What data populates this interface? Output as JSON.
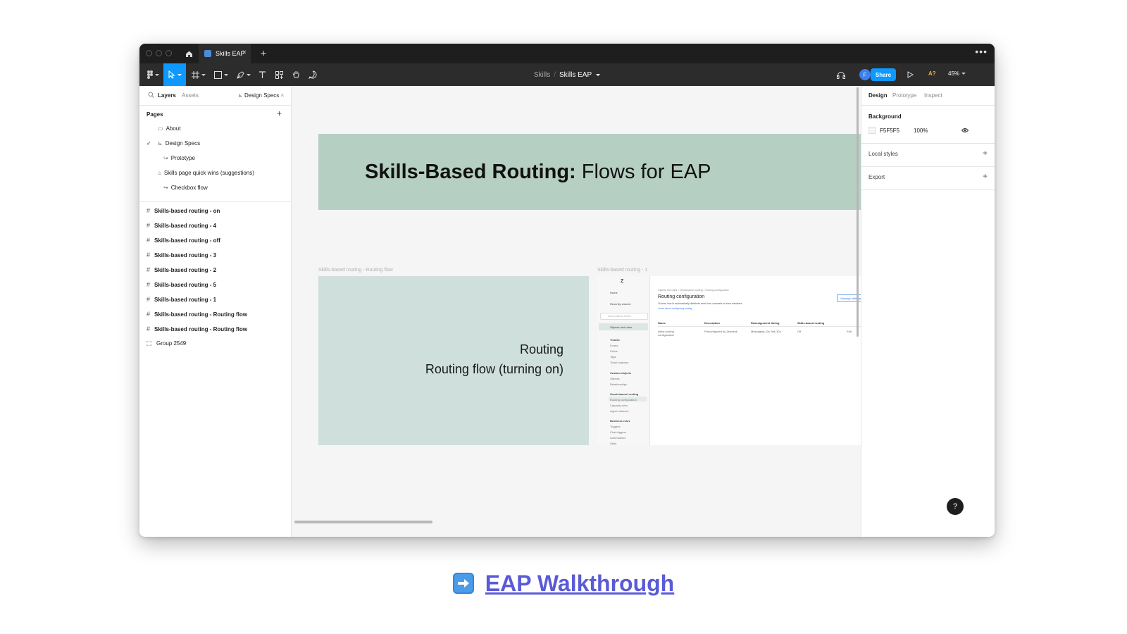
{
  "titlebar": {
    "tab_label": "Skills EAP",
    "tab_close": "×",
    "tab_add": "+",
    "more": "•••"
  },
  "toolbar": {
    "project": "Skills",
    "separator": "/",
    "file": "Skills EAP",
    "share": "Share",
    "avatar_initial": "F",
    "ai_label": "A?",
    "zoom": "45%"
  },
  "left_panel": {
    "tab_layers": "Layers",
    "tab_assets": "Assets",
    "current_page": "Design Specs",
    "pages_heading": "Pages",
    "pages_add": "+",
    "pages": [
      {
        "icon": "▭",
        "label": "About"
      },
      {
        "icon": "⊾",
        "label": "Design Specs",
        "selected": true
      },
      {
        "icon": "↪",
        "label": "Prototype"
      },
      {
        "icon": "⌂",
        "label": "Skills page quick wins (suggestions)"
      },
      {
        "icon": "↪",
        "label": "Checkbox flow"
      }
    ],
    "layers": [
      "Skills-based routing - on",
      "Skills-based routing - 4",
      "Skills-based routing - off",
      "Skills-based routing - 3",
      "Skills-based routing - 2",
      "Skills-based routing - 5",
      "Skills-based routing - 1",
      "Skills-based routing - Routing flow",
      "Skills-based routing - Routing flow",
      "Group 2549"
    ]
  },
  "canvas": {
    "banner_bold": "Skills-Based Routing:",
    "banner_rest": " Flows for EAP",
    "frame_a_label": "Skills-based routing - Routing flow",
    "frame_a_title": "Routing",
    "frame_a_subtitle": "Routing flow (turning on)",
    "frame_b_label": "Skills-based routing - 1",
    "mini": {
      "logo": "Z",
      "home": "Home",
      "recent": "Recently viewed",
      "search_placeholder": "Search Admin Center",
      "objects_rules": "Objects and rules",
      "tickets": "Tickets",
      "tickets_items": [
        "Forms",
        "Fields",
        "Tags",
        "Ticket statuses"
      ],
      "custom_objects": "Custom objects",
      "custom_items": [
        "Objects",
        "Relationships"
      ],
      "omnichannel": "Omnichannel routing",
      "omni_items": [
        "Routing configuration",
        "Capacity rules",
        "Agent statuses"
      ],
      "business_rules": "Business rules",
      "business_items": [
        "Triggers",
        "Chat triggers",
        "Automations",
        "Skills"
      ],
      "breadcrumb": "Objects and rules  >  Omnichannel routing  >  Routing configuration",
      "heading": "Routing configuration",
      "description": "Choose how to automatically distribute work from channels to team members.",
      "learn_more": "Learn about configuring routing",
      "manage_button": "Manage settings",
      "columns": [
        "Name",
        "Description",
        "Reassignment timing",
        "Skills-based routing"
      ],
      "row": [
        "Initial routing configuration",
        "Preconfigured by Zendesk",
        "Messaging 10s Talk 30s",
        "Off",
        "Edit"
      ]
    }
  },
  "right_panel": {
    "tabs": [
      "Design",
      "Prototype",
      "Inspect"
    ],
    "background_heading": "Background",
    "bg_hex": "F5F5F5",
    "bg_opacity": "100%",
    "local_styles": "Local styles",
    "export": "Export",
    "help": "?"
  },
  "footer": {
    "link_text": "EAP Walkthrough"
  },
  "colors": {
    "accent": "#0d99ff",
    "banner": "#b6cfc3",
    "frame": "#cfdfdb",
    "link": "#5a5bd6"
  }
}
